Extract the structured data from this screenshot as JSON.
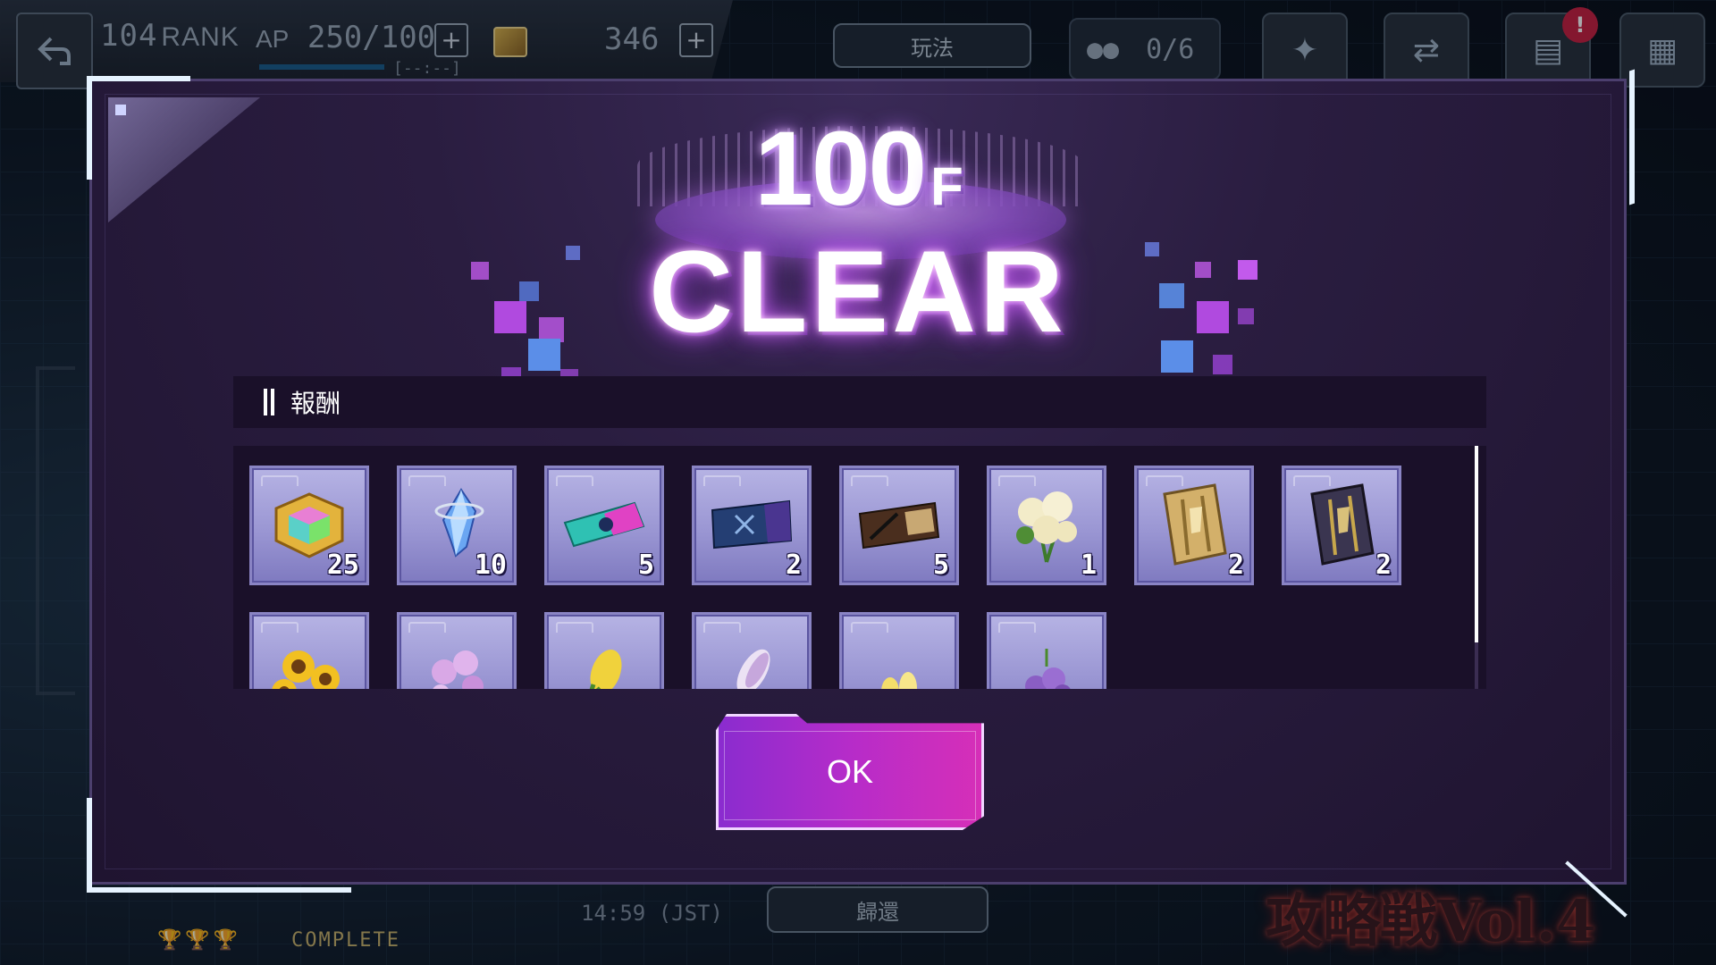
{
  "hud": {
    "rank_value": "104",
    "rank_label": "RANK",
    "ap_label": "AP",
    "ap_value": "250/100",
    "ap_timer": "[--:--]",
    "currency_value": "346",
    "play_button": "玩法",
    "party_count": "0/6",
    "notification": "!"
  },
  "backdrop": {
    "time": "14:59 (JST)",
    "return_button": "歸還",
    "complete_label": "COMPLETE",
    "event_logo": "攻略戦Vol.4"
  },
  "modal": {
    "floor_number": "100",
    "floor_suffix": "F",
    "clear_text": "CLEAR",
    "rewards_title": "報酬",
    "ok_label": "OK",
    "rewards": [
      {
        "icon": "gold-gem-cube-icon",
        "qty": "25"
      },
      {
        "icon": "blue-crystal-icon",
        "qty": "10"
      },
      {
        "icon": "teal-ticket-icon",
        "qty": "5"
      },
      {
        "icon": "dark-blue-ticket-icon",
        "qty": "2"
      },
      {
        "icon": "brown-ticket-icon",
        "qty": "5"
      },
      {
        "icon": "white-roses-icon",
        "qty": "1"
      },
      {
        "icon": "gold-tome-icon",
        "qty": "2"
      },
      {
        "icon": "dark-tome-icon",
        "qty": "2"
      },
      {
        "icon": "sunflowers-icon",
        "qty": ""
      },
      {
        "icon": "pink-flowers-icon",
        "qty": ""
      },
      {
        "icon": "yellow-bud-icon",
        "qty": ""
      },
      {
        "icon": "lavender-bud-icon",
        "qty": ""
      },
      {
        "icon": "yellow-petals-icon",
        "qty": ""
      },
      {
        "icon": "purple-bulbs-icon",
        "qty": ""
      }
    ]
  },
  "colors": {
    "accent": "#b62cc9",
    "modal_bg": "#2a1d40",
    "item_tile": "#9a96d3"
  }
}
